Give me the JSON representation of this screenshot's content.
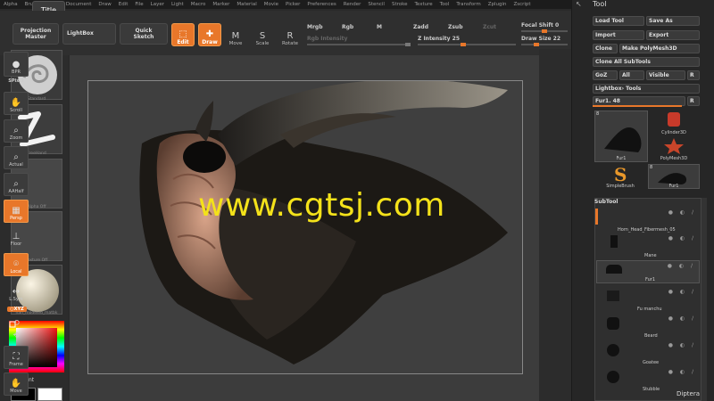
{
  "menubar": {
    "items": [
      "Alpha",
      "Brush",
      "Color",
      "Document",
      "Draw",
      "Edit",
      "File",
      "Layer",
      "Light",
      "Macro",
      "Marker",
      "Material",
      "Movie",
      "Picker",
      "Preferences",
      "Render",
      "Stencil",
      "Stroke",
      "Texture",
      "Tool",
      "Transform",
      "Zplugin",
      "Zscript"
    ]
  },
  "title_button": "Title",
  "toolbar": {
    "projection_master": "Projection\nMaster",
    "lightbox": "LightBox",
    "quick_sketch": "Quick\nSketch",
    "edit": "Edit",
    "draw": "Draw",
    "move": "Move",
    "scale": "Scale",
    "rotate": "Rotate",
    "mrgb": "Mrgb",
    "rgb": "Rgb",
    "m": "M",
    "zadd": "Zadd",
    "zsub": "Zsub",
    "zcut": "Zcut",
    "rgb_intensity": "Rgb Intensity",
    "z_intensity": "Z Intensity 25",
    "focal_shift": "Focal Shift 0",
    "draw_size": "Draw Size 22"
  },
  "left_shelf": {
    "brush_label": "Standard",
    "stroke_label": "FreeHand",
    "alpha_label": "Alpha Off",
    "texture_label": "Texture Off",
    "material_label": "nah_modeled_matbk",
    "gradient_label": "Gradient"
  },
  "watermark": "www.cgtsj.com",
  "right_shelf": {
    "bpr": "BPR",
    "spix": "SPix 3",
    "scroll": "Scroll",
    "zoom": "Zoom",
    "actual": "Actual",
    "aahalf": "AAHalf",
    "persp": "Persp",
    "floor": "Floor",
    "local": "Local",
    "lsym": "L.Sym",
    "xyz": "○XYZ",
    "frame": "Frame",
    "move": "Move"
  },
  "tool_panel": {
    "title": "Tool",
    "load_tool": "Load Tool",
    "save_as": "Save As",
    "import": "Import",
    "export": "Export",
    "clone": "Clone",
    "make_polymesh": "Make PolyMesh3D",
    "clone_all": "Clone All SubTools",
    "goz": "GoZ",
    "all": "All",
    "visible": "Visible",
    "r": "R",
    "lightbox_tools": "Lightbox› Tools",
    "current_tool": "Fur1. 48",
    "tiles": [
      {
        "label": "Fur1",
        "num": "8"
      },
      {
        "label": "Cylinder3D",
        "num": ""
      },
      {
        "label": "PolyMesh3D",
        "num": ""
      },
      {
        "label": "SimpleBrush",
        "num": ""
      },
      {
        "label": "Fur1",
        "num": "8"
      }
    ],
    "subtool_header": "SubTool",
    "subtools": [
      "Horn_Head_Fibermesh_05",
      "Mane",
      "Fur1",
      "Fu manchu",
      "Beard",
      "Goatee",
      "Stubble"
    ]
  },
  "status": "Diptera"
}
